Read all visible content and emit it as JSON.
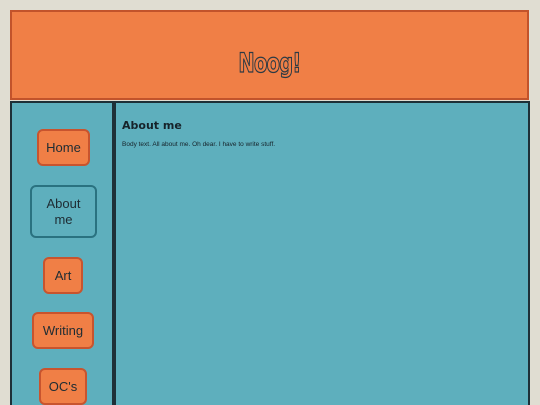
{
  "header": {
    "title": "Noog!"
  },
  "nav": {
    "items": [
      {
        "label": "Home",
        "active": false
      },
      {
        "label": "About me",
        "active": true
      },
      {
        "label": "Art",
        "active": false
      },
      {
        "label": "Writing",
        "active": false
      },
      {
        "label": "OC's",
        "active": false
      }
    ]
  },
  "main": {
    "heading": "About me",
    "body": "Body text. All about me. Oh dear. I have to write stuff."
  },
  "colors": {
    "background": "#e0ddd2",
    "header": "#f07f46",
    "panel": "#5eafbd",
    "button": "#f07f46",
    "button_active": "#5eafbd"
  }
}
